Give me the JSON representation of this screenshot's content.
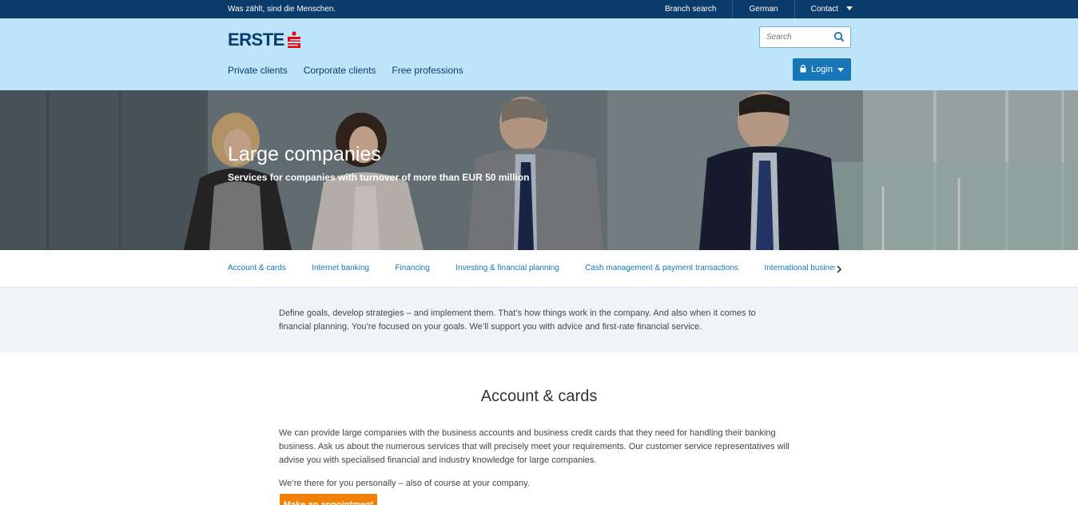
{
  "topbar": {
    "slogan": "Was zählt, sind die Menschen.",
    "links": [
      "Branch search",
      "German",
      "Contact"
    ]
  },
  "header": {
    "logo_text": "ERSTE",
    "search_placeholder": "Search",
    "nav": [
      "Private clients",
      "Corporate clients",
      "Free professions"
    ],
    "login_label": "Login"
  },
  "hero": {
    "title": "Large companies",
    "subtitle": "Services for companies with turnover of more than EUR 50 million"
  },
  "tabs": [
    "Account & cards",
    "Internet banking",
    "Financing",
    "Investing & financial planning",
    "Cash management & payment transactions",
    "International business"
  ],
  "intro": {
    "text": "Define goals, develop strategies – and implement them. That’s how things work in the company. And also when it comes to financial planning. You’re focused on your goals. We’ll support you with advice and first-rate financial service."
  },
  "section": {
    "title": "Account & cards",
    "paragraph1": "We can provide large companies with the business accounts and business credit cards that they need for handling their banking business. Ask us about the numerous services that will precisely meet your requirements. Our customer service representatives will advise you with specialised financial and industry knowledge for large companies.",
    "paragraph2": "We’re there for you personally – also of course at your company.",
    "button_label": "Make an appointment"
  },
  "colors": {
    "topbar": "#0b3b6b",
    "header": "#bde4f9",
    "accent": "#1676b6",
    "cta": "#f08105",
    "logo_red": "#e30613"
  }
}
